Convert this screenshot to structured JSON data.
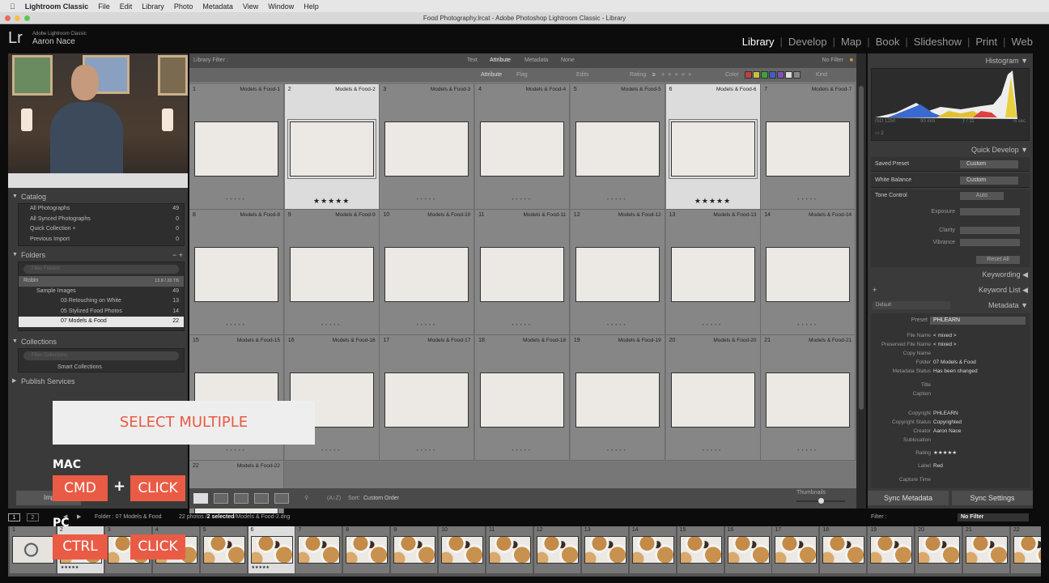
{
  "menubar": {
    "app": "Lightroom Classic",
    "items": [
      "File",
      "Edit",
      "Library",
      "Photo",
      "Metadata",
      "View",
      "Window",
      "Help"
    ]
  },
  "window": {
    "title": "Food Photography.lrcat - Adobe Photoshop Lightroom Classic - Library"
  },
  "identity": {
    "logo": "Lr",
    "product": "Adobe Lightroom Classic",
    "user": "Aaron Nace"
  },
  "modules": [
    {
      "label": "Library",
      "active": true
    },
    {
      "label": "Develop"
    },
    {
      "label": "Map"
    },
    {
      "label": "Book"
    },
    {
      "label": "Slideshow"
    },
    {
      "label": "Print"
    },
    {
      "label": "Web"
    }
  ],
  "left": {
    "catalog": {
      "title": "Catalog",
      "items": [
        {
          "label": "All Photographs",
          "count": "49"
        },
        {
          "label": "All Synced Photographs",
          "count": "0"
        },
        {
          "label": "Quick Collection +",
          "count": "0"
        },
        {
          "label": "Previous Import",
          "count": "0"
        }
      ]
    },
    "folders": {
      "title": "Folders",
      "filter_placeholder": "Filter Folders",
      "volume": "Robin",
      "volume_size": "13.8 / 20 TB",
      "items": [
        {
          "label": "Sample Images",
          "count": "49"
        },
        {
          "label": "03 Retouching on White",
          "count": "13"
        },
        {
          "label": "05 Stylized Food Photos",
          "count": "14"
        },
        {
          "label": "07 Models & Food",
          "count": "22",
          "selected": true
        }
      ]
    },
    "collections": {
      "title": "Collections",
      "filter_placeholder": "Filter Collections",
      "items": [
        "Smart Collections"
      ]
    },
    "publish": {
      "title": "Publish Services"
    },
    "import_label": "Import..."
  },
  "filter": {
    "label": "Library Filter :",
    "tabs": [
      "Text",
      "Attribute",
      "Metadata",
      "None"
    ],
    "active_tab": "Attribute",
    "preset": "No Filter",
    "attr": {
      "attribute": "Attribute",
      "flag": "Flag",
      "edits": "Edits",
      "rating": "Rating",
      "rating_op": "≥",
      "color": "Color",
      "kind": "Kind"
    },
    "colors": [
      "#c04040",
      "#c8c040",
      "#40a040",
      "#4060c0",
      "#8050b0",
      "#dddddd",
      "#888888"
    ]
  },
  "grid": {
    "cells": [
      {
        "n": "1",
        "name": "Models & Food-1",
        "rating": 0
      },
      {
        "n": "2",
        "name": "Models & Food-2",
        "rating": 5,
        "selected": true
      },
      {
        "n": "3",
        "name": "Models & Food-3",
        "rating": 0
      },
      {
        "n": "4",
        "name": "Models & Food-4",
        "rating": 0
      },
      {
        "n": "5",
        "name": "Models & Food-5",
        "rating": 0
      },
      {
        "n": "6",
        "name": "Models & Food-6",
        "rating": 5,
        "selected": true
      },
      {
        "n": "7",
        "name": "Models & Food-7",
        "rating": 0
      },
      {
        "n": "8",
        "name": "Models & Food-8",
        "rating": 0
      },
      {
        "n": "9",
        "name": "Models & Food-9",
        "rating": 0
      },
      {
        "n": "10",
        "name": "Models & Food-10",
        "rating": 0
      },
      {
        "n": "11",
        "name": "Models & Food-11",
        "rating": 0
      },
      {
        "n": "12",
        "name": "Models & Food-12",
        "rating": 0
      },
      {
        "n": "13",
        "name": "Models & Food-13",
        "rating": 0
      },
      {
        "n": "14",
        "name": "Models & Food-14",
        "rating": 0
      },
      {
        "n": "15",
        "name": "Models & Food-15",
        "rating": 0
      },
      {
        "n": "16",
        "name": "Models & Food-16",
        "rating": 0
      },
      {
        "n": "17",
        "name": "Models & Food-17",
        "rating": 0
      },
      {
        "n": "18",
        "name": "Models & Food-18",
        "rating": 0
      },
      {
        "n": "19",
        "name": "Models & Food-19",
        "rating": 0
      },
      {
        "n": "20",
        "name": "Models & Food-20",
        "rating": 0
      },
      {
        "n": "21",
        "name": "Models & Food-21",
        "rating": 0
      },
      {
        "n": "22",
        "name": "Models & Food-22",
        "rating": 0
      }
    ]
  },
  "toolbar": {
    "sort_label": "Sort:",
    "sort_value": "Custom Order",
    "thumbnails_label": "Thumbnails",
    "thumbnail_size": 0.45
  },
  "right": {
    "histogram": {
      "title": "Histogram",
      "iso": "ISO 1250",
      "focal": "90 mm",
      "aperture": "ƒ / 11",
      "shutter": "⅛ sec",
      "counts": [
        "2",
        "0",
        "0",
        "0"
      ]
    },
    "quick_develop": {
      "title": "Quick Develop",
      "saved_preset_label": "Saved Preset",
      "saved_preset": "Custom",
      "wb_label": "White Balance",
      "wb": "Custom",
      "tone_label": "Tone Control",
      "auto": "Auto",
      "exposure": "Exposure",
      "clarity": "Clarity",
      "vibrance": "Vibrance",
      "reset": "Reset All"
    },
    "keywording": "Keywording",
    "keyword_list": "Keyword List",
    "metadata": {
      "title": "Metadata",
      "view": "Default",
      "preset_label": "Preset",
      "preset": "PHLEARN",
      "fields": [
        {
          "label": "File Name",
          "value": "< mixed >"
        },
        {
          "label": "Preserved File Name",
          "value": "< mixed >"
        },
        {
          "label": "Copy Name",
          "value": ""
        },
        {
          "label": "Folder",
          "value": "07 Models & Food"
        },
        {
          "label": "Metadata Status",
          "value": "Has been changed"
        },
        {
          "label": "Title",
          "value": ""
        },
        {
          "label": "Caption",
          "value": ""
        },
        {
          "label": "Copyright",
          "value": "PHLEARN"
        },
        {
          "label": "Copyright Status",
          "value": "Copyrighted"
        },
        {
          "label": "Creator",
          "value": "Aaron Nace"
        },
        {
          "label": "Sublocation",
          "value": ""
        },
        {
          "label": "Rating",
          "value": "★★★★★"
        },
        {
          "label": "Label",
          "value": "Red"
        },
        {
          "label": "Capture Time",
          "value": ""
        }
      ]
    },
    "sync_metadata": "Sync Metadata",
    "sync_settings": "Sync Settings"
  },
  "filmbar": {
    "screen1": "1",
    "screen2": "2",
    "source": "Folder : 07 Models & Food",
    "count": "22 photos /",
    "selected": "2 selected",
    "file": "/Models & Food-2.dng",
    "filter_label": "Filter :",
    "filter_value": "No Filter"
  },
  "overlay": {
    "title": "SELECT MULTIPLE",
    "mac": "MAC",
    "mac_key": "CMD",
    "plus": "+",
    "click": "CLICK",
    "pc": "PC",
    "pc_key": "CTRL"
  }
}
